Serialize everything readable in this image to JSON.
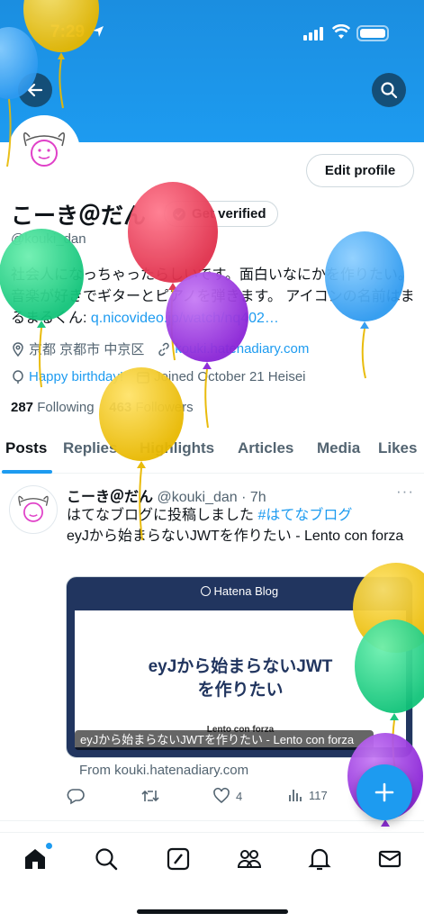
{
  "status_bar": {
    "time": "7:29"
  },
  "profile": {
    "name": "こーき＠だん",
    "verified_label": "Get verified",
    "handle": "@kouki_dan",
    "edit_profile_label": "Edit profile",
    "bio_text": "社会人になっちゃったらしいです。面白いなにかを作りたい。 音楽が好きでギターとピアノを弾きます。 アイコンの名前はまるまるくん: ",
    "bio_link": "q.nicovideo.jp/watch/nq402…",
    "location": "京都 京都市 中京区",
    "website": "kouki.hatenadiary.com",
    "birthday": "Happy birthday!",
    "joined": "Joined October 21 Heisei",
    "following_count": "287",
    "following_label": "Following",
    "followers_count": "463",
    "followers_label": "Followers"
  },
  "tabs": [
    "Posts",
    "Replies",
    "Highlights",
    "Articles",
    "Media",
    "Likes"
  ],
  "tweet": {
    "name": "こーき＠だん",
    "handle_time": "@kouki_dan · 7h",
    "text": "はてなブログに投稿しました ",
    "hashtag": "#はてなブログ",
    "text2": "eyJから始まらないJWTを作りたい - Lento con forza",
    "card_brand": "Hatena Blog",
    "card_title": "eyJから始まらないJWTを作りたい",
    "card_blog": "Lento con forza",
    "card_caption": "eyJから始まらないJWTを作りたい - Lento con forza",
    "from": "From kouki.hatenadiary.com",
    "likes": "4",
    "views": "117",
    "more": "···"
  },
  "icons": [
    "back-arrow-icon",
    "search-icon",
    "location-icon",
    "link-icon",
    "balloon-icon",
    "calendar-icon",
    "reply-icon",
    "retweet-icon",
    "like-icon",
    "views-icon",
    "compose-icon",
    "home-icon",
    "explore-icon",
    "grok-icon",
    "communities-icon",
    "notifications-icon",
    "messages-icon"
  ],
  "colors": {
    "accent": "#1d9bf0",
    "banner": "#1d9bf0",
    "text": "#0f1419",
    "muted": "#536471"
  }
}
